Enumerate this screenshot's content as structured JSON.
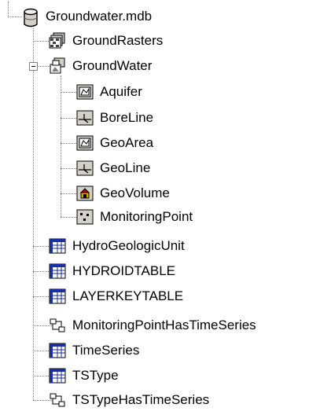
{
  "tree": {
    "root": {
      "label": "Groundwater.mdb",
      "icon": "database-icon"
    },
    "items": [
      {
        "label": "GroundRasters",
        "icon": "raster-catalog-icon"
      },
      {
        "label": "GroundWater",
        "icon": "feature-dataset-icon",
        "expanded": true
      },
      {
        "label": "Aquifer",
        "icon": "polygon-feature-class-icon"
      },
      {
        "label": "BoreLine",
        "icon": "line-feature-class-icon"
      },
      {
        "label": "GeoArea",
        "icon": "polygon-feature-class-icon"
      },
      {
        "label": "GeoLine",
        "icon": "line-feature-class-icon"
      },
      {
        "label": "GeoVolume",
        "icon": "multipatch-feature-class-icon"
      },
      {
        "label": "MonitoringPoint",
        "icon": "point-feature-class-icon"
      },
      {
        "label": "HydroGeologicUnit",
        "icon": "table-icon"
      },
      {
        "label": "HYDROIDTABLE",
        "icon": "table-icon"
      },
      {
        "label": "LAYERKEYTABLE",
        "icon": "table-icon"
      },
      {
        "label": "MonitoringPointHasTimeSeries",
        "icon": "relationship-class-icon"
      },
      {
        "label": "TimeSeries",
        "icon": "table-icon"
      },
      {
        "label": "TSType",
        "icon": "table-icon"
      },
      {
        "label": "TSTypeHasTimeSeries",
        "icon": "relationship-class-icon"
      }
    ]
  }
}
